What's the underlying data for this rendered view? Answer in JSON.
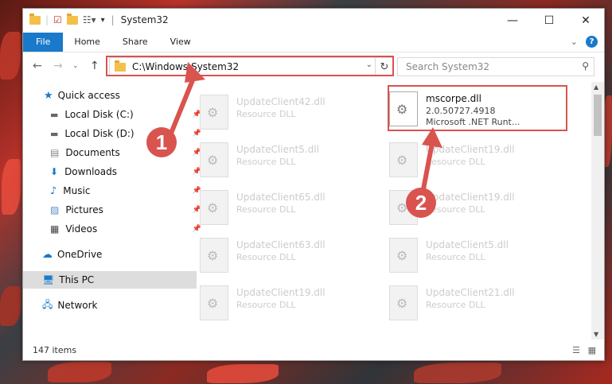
{
  "window": {
    "title": "System32",
    "controls": {
      "minimize": "—",
      "maximize": "☐",
      "close": "✕"
    }
  },
  "ribbon": {
    "tabs": [
      "File",
      "Home",
      "Share",
      "View"
    ]
  },
  "navigation": {
    "address": "C:\\Windows\\System32",
    "search_placeholder": "Search System32"
  },
  "sidebar": {
    "items": [
      {
        "label": "Quick access",
        "icon": "star-icon"
      },
      {
        "label": "Local Disk (C:)",
        "icon": "drive-icon"
      },
      {
        "label": "Local Disk (D:)",
        "icon": "drive-icon"
      },
      {
        "label": "Documents",
        "icon": "documents-icon"
      },
      {
        "label": "Downloads",
        "icon": "download-icon"
      },
      {
        "label": "Music",
        "icon": "music-icon"
      },
      {
        "label": "Pictures",
        "icon": "pictures-icon"
      },
      {
        "label": "Videos",
        "icon": "videos-icon"
      },
      {
        "label": "OneDrive",
        "icon": "cloud-icon"
      },
      {
        "label": "This PC",
        "icon": "computer-icon"
      },
      {
        "label": "Network",
        "icon": "network-icon"
      }
    ]
  },
  "files": {
    "left": [
      {
        "name": "UpdateClient42.dll",
        "desc": "Resource DLL"
      },
      {
        "name": "UpdateClient5.dll",
        "desc": "Resource DLL"
      },
      {
        "name": "UpdateClient65.dll",
        "desc": "Resource DLL"
      },
      {
        "name": "UpdateClient63.dll",
        "desc": "Resource DLL"
      },
      {
        "name": "UpdateClient19.dll",
        "desc": "Resource DLL"
      }
    ],
    "right": [
      {
        "name": "mscorpe.dll",
        "version": "2.0.50727.4918",
        "desc": "Microsoft .NET Runt..."
      },
      {
        "name": "UpdateClient19.dll",
        "desc": "Resource DLL"
      },
      {
        "name": "UpdateClient19.dll",
        "desc": "Resource DLL"
      },
      {
        "name": "UpdateClient5.dll",
        "desc": "Resource DLL"
      },
      {
        "name": "UpdateClient21.dll",
        "desc": "Resource DLL"
      }
    ]
  },
  "status": {
    "count": "147 items"
  },
  "annotations": {
    "badge1": "1",
    "badge2": "2",
    "color": "#d9534f"
  }
}
